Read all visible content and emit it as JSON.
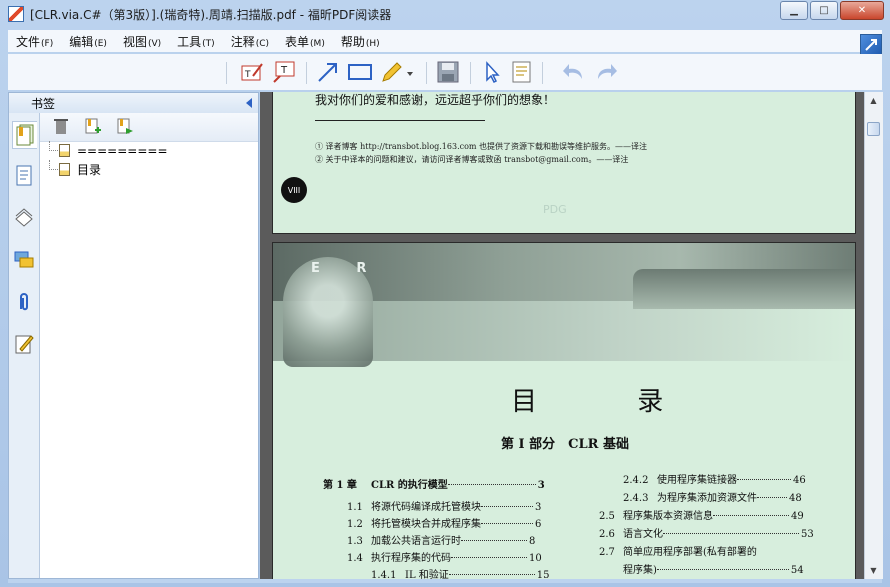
{
  "window": {
    "title": "[CLR.via.C#（第3版）].(瑞奇特).周靖.扫描版.pdf - 福昕PDF阅读器",
    "minimize_label": "▁",
    "maximize_label": "□",
    "close_label": "✕"
  },
  "menu": [
    {
      "label": "文件",
      "acc": "(F)"
    },
    {
      "label": "编辑",
      "acc": "(E)"
    },
    {
      "label": "视图",
      "acc": "(V)"
    },
    {
      "label": "工具",
      "acc": "(T)"
    },
    {
      "label": "注释",
      "acc": "(C)"
    },
    {
      "label": "表单",
      "acc": "(M)"
    },
    {
      "label": "帮助",
      "acc": "(H)"
    }
  ],
  "toolbar_icons": [
    "typewriter-icon",
    "textbox-icon",
    "arrow-line-icon",
    "rectangle-icon",
    "pencil-icon",
    "dropdown-icon",
    "save-icon",
    "select-cursor-icon",
    "text-select-icon",
    "undo-icon",
    "redo-icon"
  ],
  "sidebar": {
    "title": "书签",
    "tab_icons": [
      "bookmarks-icon",
      "pages-icon",
      "layers-icon",
      "comments-icon",
      "attachments-icon",
      "signatures-icon"
    ],
    "tools": [
      "delete-icon",
      "add-bookmark-icon",
      "add-child-bookmark-icon"
    ],
    "bookmarks": [
      {
        "label": "========="
      },
      {
        "label": "目录"
      }
    ]
  },
  "document": {
    "page1": {
      "text": "我对你们的爱和感谢，远远超乎你们的想象！",
      "footnote1": "① 译者博客 http://transbot.blog.163.com 也提供了资源下载和勘误等维护服务。——译注",
      "footnote2": "② 关于中译本的问题和建议，请访问译者博客或致函 transbot@gmail.com。——译注",
      "page_number": "VIII",
      "watermark": "PDG"
    },
    "page2": {
      "header_letters": "E R",
      "toc_title": "目 录",
      "part_title": "第 I 部分　CLR 基础",
      "left_col": [
        {
          "num": "第 1 章",
          "title": "CLR 的执行模型",
          "page": "3",
          "bold": true
        },
        {
          "num": "1.1",
          "title": "将源代码编译成托管模块",
          "page": "3"
        },
        {
          "num": "1.2",
          "title": "将托管模块合并成程序集",
          "page": "6"
        },
        {
          "num": "1.3",
          "title": "加载公共语言运行时",
          "page": "8"
        },
        {
          "num": "1.4",
          "title": "执行程序集的代码",
          "page": "10"
        },
        {
          "num": "1.4.1",
          "title": "IL 和验证",
          "page": "15"
        }
      ],
      "right_col": [
        {
          "num": "2.4.2",
          "title": "使用程序集链接器",
          "page": "46"
        },
        {
          "num": "2.4.3",
          "title": "为程序集添加资源文件",
          "page": "48"
        },
        {
          "num": "2.5",
          "title": "程序集版本资源信息",
          "page": "49"
        },
        {
          "num": "2.6",
          "title": "语言文化",
          "page": "53"
        },
        {
          "num": "2.7",
          "title": "简单应用程序部署(私有部署的",
          "page": ""
        },
        {
          "num": "",
          "title": "程序集)",
          "page": "54"
        }
      ]
    }
  },
  "colors": {
    "page_bg": "#d7eedd",
    "chrome": "#bcd3ee",
    "menu_bg": "#f3f7fc"
  }
}
